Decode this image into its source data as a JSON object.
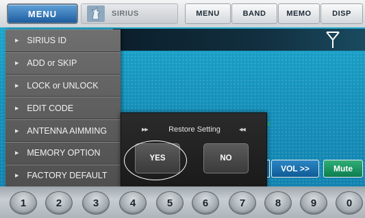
{
  "topbar": {
    "menu_label": "MENU",
    "source_label": "SIRIUS",
    "source_icon": "sirius-dog-icon",
    "buttons": [
      "MENU",
      "BAND",
      "MEMO",
      "DISP"
    ]
  },
  "display": {
    "antenna_icon": "antenna-icon"
  },
  "side_menu": {
    "items": [
      "SIRIUS ID",
      "ADD or SKIP",
      "LOCK or UNLOCK",
      "EDIT CODE",
      "ANTENNA AIMMING",
      "MEMORY OPTION",
      "FACTORY DEFAULT"
    ]
  },
  "popup": {
    "left_arrows": "▶▶",
    "title": "Restore Setting",
    "right_arrows": "◀◀",
    "yes_label": "YES",
    "no_label": "NO"
  },
  "controls": {
    "vol_label": "VOL >>",
    "mute_label": "Mute"
  },
  "presets": [
    "1",
    "2",
    "3",
    "4",
    "5",
    "6",
    "7",
    "8",
    "9",
    "0"
  ],
  "colors": {
    "menu_accent": "#1d5c9f",
    "display_bg": "#1591bb",
    "vol_button": "#0f5b95",
    "mute_button": "#0d7d4f"
  }
}
